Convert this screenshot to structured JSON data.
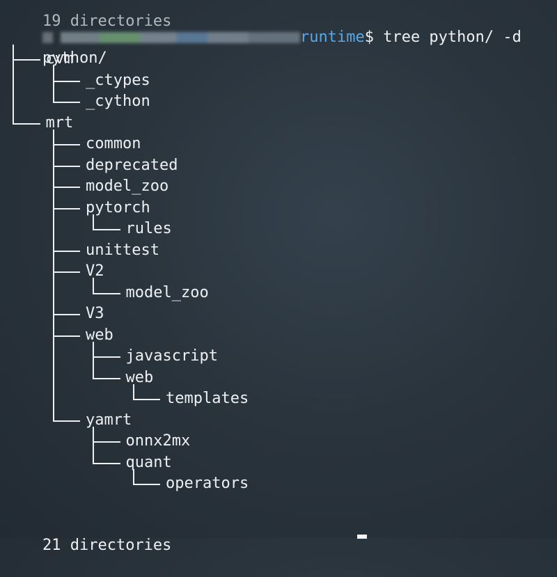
{
  "terminal": {
    "previous_output": "19 directories",
    "prompt": {
      "directory": "runtime",
      "symbol": "$",
      "command": "tree python/ -d"
    },
    "root": "python/",
    "tree": [
      {
        "name": "cvm",
        "depth": 1
      },
      {
        "name": "_ctypes",
        "depth": 2
      },
      {
        "name": "_cython",
        "depth": 2
      },
      {
        "name": "mrt",
        "depth": 1
      },
      {
        "name": "common",
        "depth": 2
      },
      {
        "name": "deprecated",
        "depth": 2
      },
      {
        "name": "model_zoo",
        "depth": 2
      },
      {
        "name": "pytorch",
        "depth": 2
      },
      {
        "name": "rules",
        "depth": 3
      },
      {
        "name": "unittest",
        "depth": 2
      },
      {
        "name": "V2",
        "depth": 2
      },
      {
        "name": "model_zoo",
        "depth": 3
      },
      {
        "name": "V3",
        "depth": 2
      },
      {
        "name": "web",
        "depth": 2
      },
      {
        "name": "javascript",
        "depth": 3
      },
      {
        "name": "web",
        "depth": 3
      },
      {
        "name": "templates",
        "depth": 4
      },
      {
        "name": "yamrt",
        "depth": 2
      },
      {
        "name": "onnx2mx",
        "depth": 3
      },
      {
        "name": "quant",
        "depth": 3
      },
      {
        "name": "operators",
        "depth": 4
      }
    ],
    "summary": "21 directories"
  }
}
